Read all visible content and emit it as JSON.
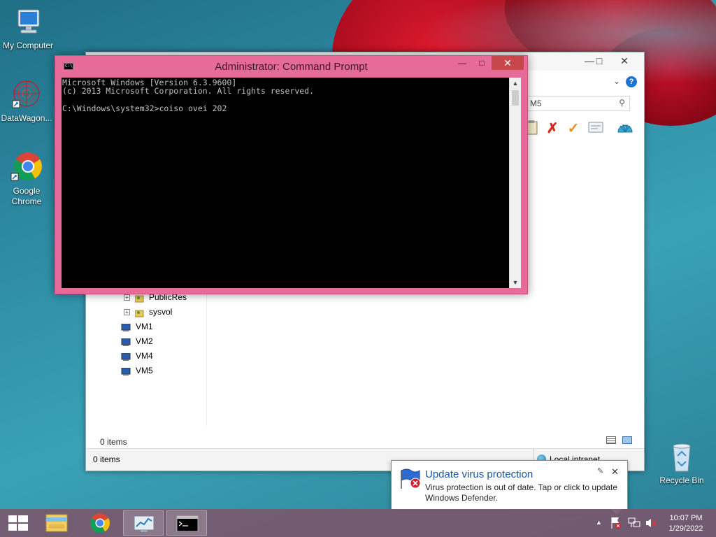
{
  "desktop": {
    "icons": [
      {
        "label": "My Computer"
      },
      {
        "label": "DataWagon..."
      },
      {
        "label": "Google Chrome"
      },
      {
        "label": "Recycle Bin"
      }
    ]
  },
  "explorer": {
    "search_text": "M5",
    "tree": [
      {
        "label": "PublicRes"
      },
      {
        "label": "sysvol"
      },
      {
        "label": "VM1"
      },
      {
        "label": "VM2"
      },
      {
        "label": "VM4"
      },
      {
        "label": "VM5"
      }
    ],
    "pane_status": "0 items",
    "status_left": "0 items",
    "status_right": "Local intranet"
  },
  "cmd": {
    "title": "Administrator: Command Prompt",
    "line1": "Microsoft Windows [Version 6.3.9600]",
    "line2": "(c) 2013 Microsoft Corporation. All rights reserved.",
    "line3": "",
    "line4": "C:\\Windows\\system32>coiso ovei 202"
  },
  "toast": {
    "title": "Update virus protection",
    "message": "Virus protection is out of date. Tap or click to update Windows Defender."
  },
  "taskbar": {
    "time": "10:07 PM",
    "date": "1/29/2022"
  },
  "colors": {
    "cmd_frame": "#e76b98",
    "taskbar": "#78586e",
    "toast_title": "#1a56a8"
  }
}
